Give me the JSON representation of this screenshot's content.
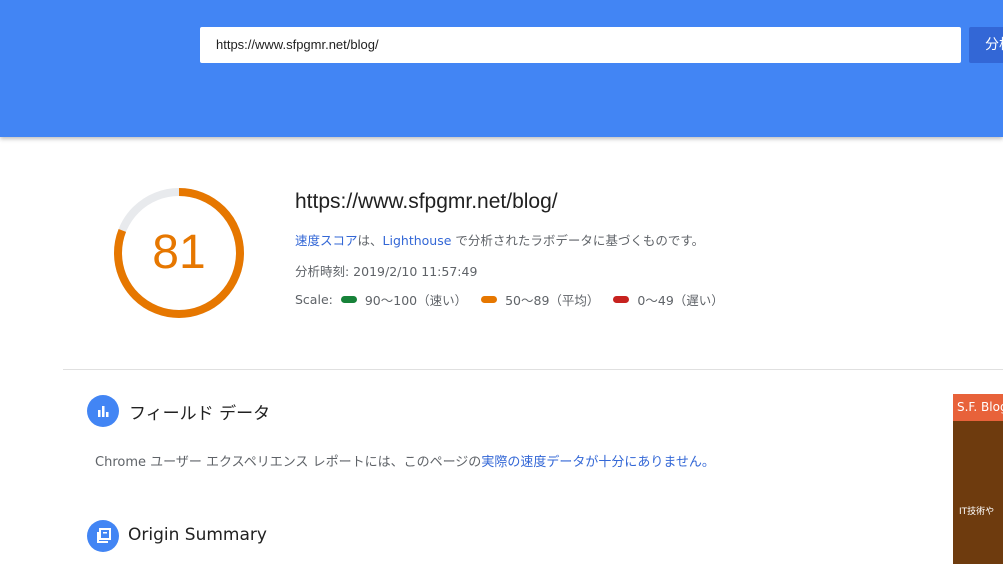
{
  "header": {
    "url_value": "https://www.sfpgmr.net/blog/",
    "analyze_label": "分析"
  },
  "summary": {
    "score": "81",
    "score_value": 81,
    "url": "https://www.sfpgmr.net/blog/",
    "speed_link": "速度スコア",
    "desc_mid": "は、",
    "lighthouse_link": "Lighthouse",
    "desc_end": " で分析されたラボデータに基づくものです。",
    "analysis_time": "分析時刻: 2019/2/10 11:57:49",
    "scale_label": "Scale:",
    "scale": [
      {
        "text": "90～100（速い）",
        "color": "#178239"
      },
      {
        "text": "50～89（平均）",
        "color": "#e67700"
      },
      {
        "text": "0～49（遅い）",
        "color": "#c7221f"
      }
    ]
  },
  "field_data": {
    "title": "フィールド データ",
    "desc_start": "Chrome ユーザー エクスペリエンス レポートには、このページの",
    "desc_link": "実際の速度データが十分にありません。"
  },
  "origin_summary": {
    "title": "Origin Summary"
  },
  "thumbnail": {
    "header": "S.F. Blog",
    "body": "IT技術や"
  },
  "colors": {
    "header_bg": "#4285f4",
    "score_orange": "#e67700",
    "link": "#3367d6"
  }
}
